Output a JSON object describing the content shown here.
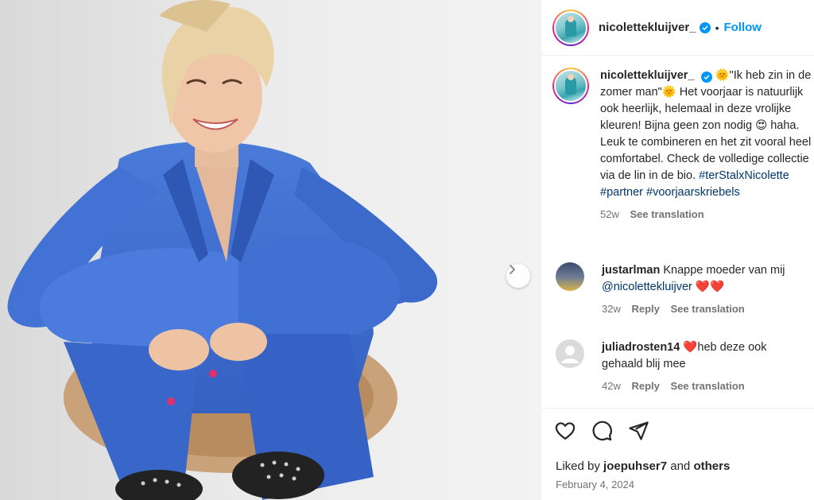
{
  "post": {
    "username": "nicolettekluijver_",
    "follow_label": "Follow",
    "dot": "•",
    "caption_lead": "🌞\"Ik heb zin in de zomer man\"🌞 Het voorjaar is natuurlijk ook heerlijk, helemaal in deze vrolijke kleuren! Bijna geen zon nodig 😍 haha. Leuk te combineren en het zit vooral heel comfortabel. Check de volledige collectie via de lin in de bio.",
    "hashtags": [
      "#terStalxNicolette",
      "#partner",
      "#voorjaarskriebels"
    ],
    "caption_age": "52w",
    "see_translation": "See translation"
  },
  "comments": [
    {
      "user": "justarlman",
      "text": "Knappe moeder van mij",
      "mention": "@nicolettekluijver",
      "emoji": "❤️❤️",
      "age": "32w",
      "reply": "Reply",
      "see_translation": "See translation"
    },
    {
      "user": "juliadrosten14",
      "emoji": "❤️",
      "text": "heb deze ook gehaald blij mee",
      "age": "42w",
      "reply": "Reply",
      "see_translation": "See translation"
    }
  ],
  "footer": {
    "liked_prefix": "Liked by",
    "liked_user": "joepuhser7",
    "liked_and": "and",
    "liked_others": "others",
    "date": "February 4, 2024"
  },
  "icons": {
    "like": "heart-outline-icon",
    "comment": "comment-bubble-icon",
    "share": "paper-plane-icon",
    "next": "chevron-right-icon",
    "verified": "verified-badge-icon"
  },
  "colors": {
    "accent": "#0095f6",
    "suit": "#3f6fd0",
    "hashtag": "#00376b"
  }
}
